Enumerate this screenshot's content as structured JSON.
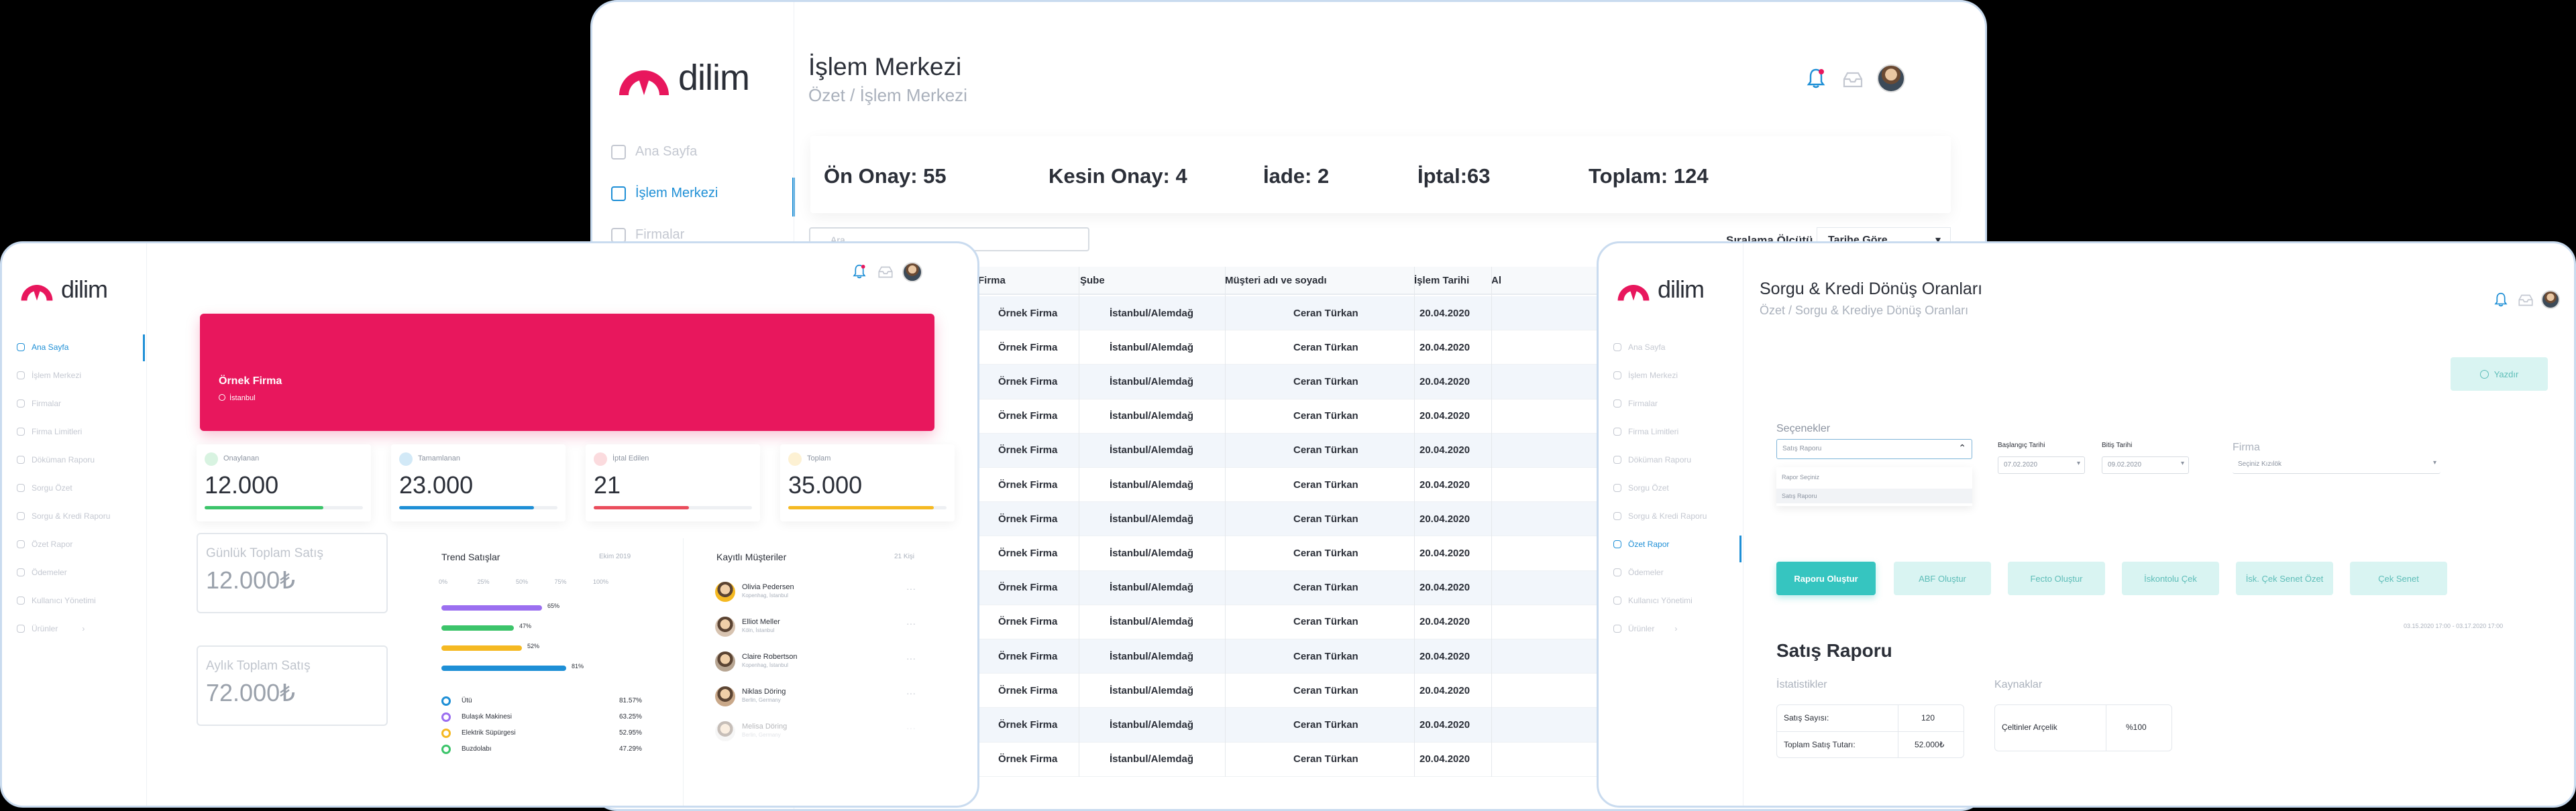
{
  "brand": {
    "name": "dilim",
    "accent": "#e8175d",
    "primary": "#1e8fd6",
    "teal": "#36c5c0"
  },
  "main_window": {
    "title": "İşlem Merkezi",
    "breadcrumb": "Özet / İşlem Merkezi",
    "sidebar": [
      {
        "label": "Ana Sayfa",
        "icon": "grid-icon"
      },
      {
        "label": "İşlem Merkezi",
        "icon": "columns-icon",
        "active": true
      },
      {
        "label": "Firmalar",
        "icon": "building-icon"
      }
    ],
    "summary": {
      "on_onay": "Ön Onay: 55",
      "kesin_onay": "Kesin Onay: 4",
      "iade": "İade: 2",
      "iptal": "İptal:63",
      "toplam": "Toplam: 124"
    },
    "search_placeholder": "Ara",
    "sort_label": "Sıralama Ölçütü",
    "sort_value": "Tarihe Göre",
    "table": {
      "headers": [
        "Firma",
        "Şube",
        "Müşteri adı ve soyadı",
        "İşlem Tarihi",
        "Al"
      ],
      "rows": [
        [
          "Örnek Firma",
          "İstanbul/Alemdağ",
          "Ceran Türkan",
          "20.04.2020"
        ],
        [
          "Örnek Firma",
          "İstanbul/Alemdağ",
          "Ceran Türkan",
          "20.04.2020"
        ],
        [
          "Örnek Firma",
          "İstanbul/Alemdağ",
          "Ceran Türkan",
          "20.04.2020"
        ],
        [
          "Örnek Firma",
          "İstanbul/Alemdağ",
          "Ceran Türkan",
          "20.04.2020"
        ],
        [
          "Örnek Firma",
          "İstanbul/Alemdağ",
          "Ceran Türkan",
          "20.04.2020"
        ],
        [
          "Örnek Firma",
          "İstanbul/Alemdağ",
          "Ceran Türkan",
          "20.04.2020"
        ],
        [
          "Örnek Firma",
          "İstanbul/Alemdağ",
          "Ceran Türkan",
          "20.04.2020"
        ],
        [
          "Örnek Firma",
          "İstanbul/Alemdağ",
          "Ceran Türkan",
          "20.04.2020"
        ],
        [
          "Örnek Firma",
          "İstanbul/Alemdağ",
          "Ceran Türkan",
          "20.04.2020"
        ],
        [
          "Örnek Firma",
          "İstanbul/Alemdağ",
          "Ceran Türkan",
          "20.04.2020"
        ],
        [
          "Örnek Firma",
          "İstanbul/Alemdağ",
          "Ceran Türkan",
          "20.04.2020"
        ],
        [
          "Örnek Firma",
          "İstanbul/Alemdağ",
          "Ceran Türkan",
          "20.04.2020"
        ],
        [
          "Örnek Firma",
          "İstanbul/Alemdağ",
          "Ceran Türkan",
          "20.04.2020"
        ],
        [
          "Örnek Firma",
          "İstanbul/Alemdağ",
          "Ceran Türkan",
          "20.04.2020"
        ]
      ]
    }
  },
  "left_window": {
    "sidebar": [
      {
        "label": "Ana Sayfa",
        "icon": "grid-icon",
        "active": true
      },
      {
        "label": "İşlem Merkezi",
        "icon": "columns-icon"
      },
      {
        "label": "Firmalar",
        "icon": "building-icon"
      },
      {
        "label": "Firma Limitleri",
        "icon": "limit-icon"
      },
      {
        "label": "Döküman Raporu",
        "icon": "document-icon"
      },
      {
        "label": "Sorgu Özet",
        "icon": "search-doc-icon"
      },
      {
        "label": "Sorgu & Kredi Raporu",
        "icon": "report-icon"
      },
      {
        "label": "Özet Rapor",
        "icon": "summary-icon"
      },
      {
        "label": "Ödemeler",
        "icon": "tag-icon"
      },
      {
        "label": "Kullanıcı Yönetimi",
        "icon": "users-icon"
      },
      {
        "label": "Ürünler",
        "icon": "box-icon",
        "chevron": "›"
      }
    ],
    "hero": {
      "company": "Örnek Firma",
      "location": "İstanbul"
    },
    "stats": [
      {
        "label": "Onaylanan",
        "value": "12.000",
        "color": "#3cc46a",
        "fill": 0.75
      },
      {
        "label": "Tamamlanan",
        "value": "23.000",
        "color": "#1e8fd6",
        "fill": 0.85
      },
      {
        "label": "İptal Edilen",
        "value": "21",
        "color": "#ea4d5c",
        "fill": 0.6
      },
      {
        "label": "Toplam",
        "value": "35.000",
        "color": "#f5b922",
        "fill": 0.92
      }
    ],
    "daily_sales": {
      "label": "Günlük Toplam Satış",
      "value": "12.000₺"
    },
    "monthly_sales": {
      "label": "Aylık Toplam Satış",
      "value": "72.000₺"
    },
    "trend": {
      "title": "Trend Satışlar",
      "period": "Ekim 2019",
      "axis": [
        "0%",
        "25%",
        "50%",
        "75%",
        "100%"
      ],
      "bars": [
        {
          "label": "65%",
          "value": 65,
          "color": "#9b6ff0"
        },
        {
          "label": "47%",
          "value": 47,
          "color": "#3cc46a"
        },
        {
          "label": "52%",
          "value": 52,
          "color": "#f5b922"
        },
        {
          "label": "81%",
          "value": 81,
          "color": "#1e8fd6"
        }
      ],
      "legend": [
        {
          "name": "Ütü",
          "value": "81.57%",
          "color": "#1e8fd6"
        },
        {
          "name": "Bulaşık Makinesi",
          "value": "63.25%",
          "color": "#9b6ff0"
        },
        {
          "name": "Elektrik Süpürgesi",
          "value": "52.95%",
          "color": "#f5b922"
        },
        {
          "name": "Buzdolabı",
          "value": "47.29%",
          "color": "#3cc46a"
        }
      ]
    },
    "customers": {
      "title": "Kayıtlı Müşteriler",
      "count": "21 Kişi",
      "list": [
        {
          "name": "Olivia Pedersen",
          "city": "Kopenhag, İstanbul"
        },
        {
          "name": "Elliot Meller",
          "city": "Köln, İstanbul"
        },
        {
          "name": "Claire Robertson",
          "city": "Kopenhag, İstanbul"
        },
        {
          "name": "Niklas Döring",
          "city": "Berlin, Germany"
        },
        {
          "name": "Melisa Döring",
          "city": "Berlin, Germany"
        }
      ]
    }
  },
  "right_window": {
    "title": "Sorgu & Kredi Dönüş Oranları",
    "breadcrumb": "Özet / Sorgu & Krediye Dönüş Oranları",
    "sidebar": [
      {
        "label": "Ana Sayfa"
      },
      {
        "label": "İşlem Merkezi"
      },
      {
        "label": "Firmalar"
      },
      {
        "label": "Firma Limitleri"
      },
      {
        "label": "Döküman Raporu"
      },
      {
        "label": "Sorgu Özet"
      },
      {
        "label": "Sorgu & Kredi Raporu"
      },
      {
        "label": "Özet Rapor",
        "active": true
      },
      {
        "label": "Ödemeler"
      },
      {
        "label": "Kullanıcı Yönetimi"
      },
      {
        "label": "Ürünler",
        "chevron": "›"
      }
    ],
    "print_label": "Yazdır",
    "options": {
      "title": "Seçenekler",
      "selected": "Satış Raporu",
      "dropdown": [
        "Rapor Seçiniz",
        "Satış Raporu"
      ]
    },
    "start_date": {
      "label": "Başlangıç Tarihi",
      "value": "07.02.2020"
    },
    "end_date": {
      "label": "Bitiş Tarihi",
      "value": "09.02.2020"
    },
    "firma": {
      "label": "Firma",
      "placeholder": "Seçiniz Kızılök"
    },
    "buttons": [
      "Raporu Oluştur",
      "ABF Oluştur",
      "Fecto Oluştur",
      "İskontolu Çek",
      "İsk. Çek Senet Özet",
      "Çek Senet"
    ],
    "date_range": "03.15.2020 17:00 - 03.17.2020 17:00",
    "report": {
      "title": "Satış Raporu",
      "stats_title": "İstatistikler",
      "sources_title": "Kaynaklar",
      "stats": [
        {
          "label": "Satış Sayısı:",
          "value": "120"
        },
        {
          "label": "Toplam Satış Tutarı:",
          "value": "52.000₺"
        }
      ],
      "sources": [
        {
          "label": "Çeltinler Arçelik",
          "value": "%100"
        }
      ]
    }
  }
}
